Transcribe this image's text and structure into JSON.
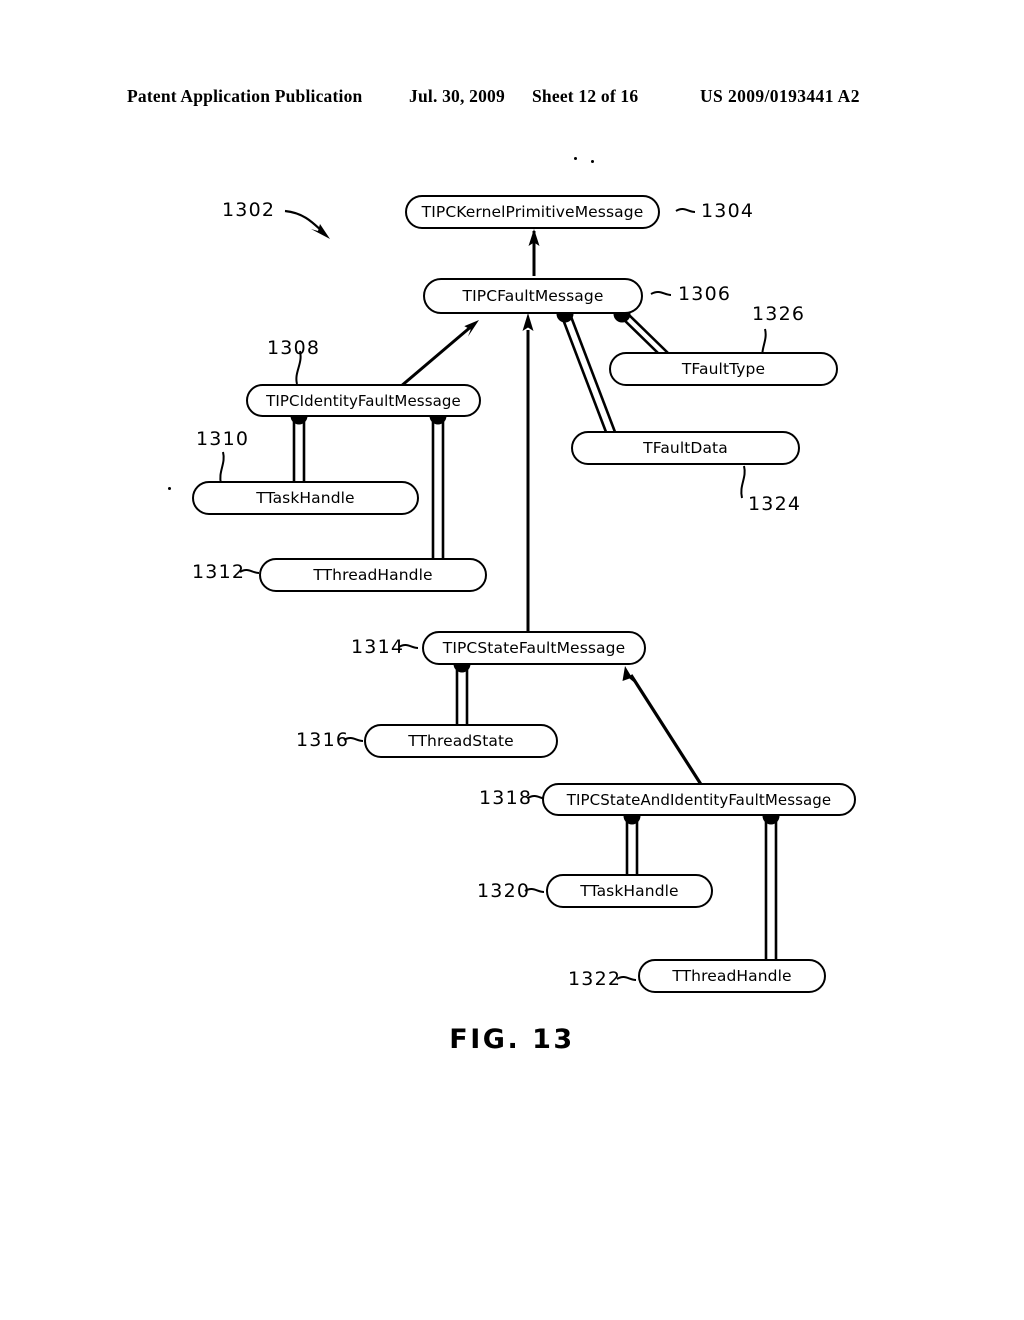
{
  "header": {
    "publication": "Patent Application Publication",
    "date": "Jul. 30, 2009",
    "sheet": "Sheet 12 of 16",
    "number": "US 2009/0193441 A2"
  },
  "figure": {
    "caption": "FIG. 13",
    "diagram_ref": "1302",
    "nodes": [
      {
        "id": "n1304",
        "ref": "1304",
        "label": "TIPCKernelPrimitiveMessage"
      },
      {
        "id": "n1306",
        "ref": "1306",
        "label": "TIPCFaultMessage"
      },
      {
        "id": "n1308",
        "ref": "1308",
        "label": "TIPCIdentityFaultMessage"
      },
      {
        "id": "n1310",
        "ref": "1310",
        "label": "TTaskHandle"
      },
      {
        "id": "n1312",
        "ref": "1312",
        "label": "TThreadHandle"
      },
      {
        "id": "n1314",
        "ref": "1314",
        "label": "TIPCStateFaultMessage"
      },
      {
        "id": "n1316",
        "ref": "1316",
        "label": "TThreadState"
      },
      {
        "id": "n1318",
        "ref": "1318",
        "label": "TIPCStateAndIdentityFaultMessage"
      },
      {
        "id": "n1320",
        "ref": "1320",
        "label": "TTaskHandle"
      },
      {
        "id": "n1322",
        "ref": "1322",
        "label": "TThreadHandle"
      },
      {
        "id": "n1324",
        "ref": "1324",
        "label": "TFaultData"
      },
      {
        "id": "n1326",
        "ref": "1326",
        "label": "TFaultType"
      }
    ],
    "relations": [
      {
        "from": "TIPCFaultMessage",
        "to": "TIPCKernelPrimitiveMessage",
        "type": "inheritance"
      },
      {
        "from": "TIPCIdentityFaultMessage",
        "to": "TIPCFaultMessage",
        "type": "inheritance"
      },
      {
        "from": "TIPCStateFaultMessage",
        "to": "TIPCFaultMessage",
        "type": "inheritance"
      },
      {
        "from": "TIPCStateAndIdentityFaultMessage",
        "to": "TIPCStateFaultMessage",
        "type": "inheritance"
      },
      {
        "from": "TIPCFaultMessage",
        "to": "TFaultData",
        "type": "composition"
      },
      {
        "from": "TIPCFaultMessage",
        "to": "TFaultType",
        "type": "composition"
      },
      {
        "from": "TIPCIdentityFaultMessage",
        "to": "TTaskHandle",
        "type": "composition"
      },
      {
        "from": "TIPCIdentityFaultMessage",
        "to": "TThreadHandle",
        "type": "composition"
      },
      {
        "from": "TIPCStateFaultMessage",
        "to": "TThreadState",
        "type": "composition"
      },
      {
        "from": "TIPCStateAndIdentityFaultMessage",
        "to": "TTaskHandle",
        "type": "composition"
      },
      {
        "from": "TIPCStateAndIdentityFaultMessage",
        "to": "TThreadHandle",
        "type": "composition"
      }
    ]
  },
  "colors": {
    "ink": "#000000",
    "paper": "#ffffff"
  }
}
